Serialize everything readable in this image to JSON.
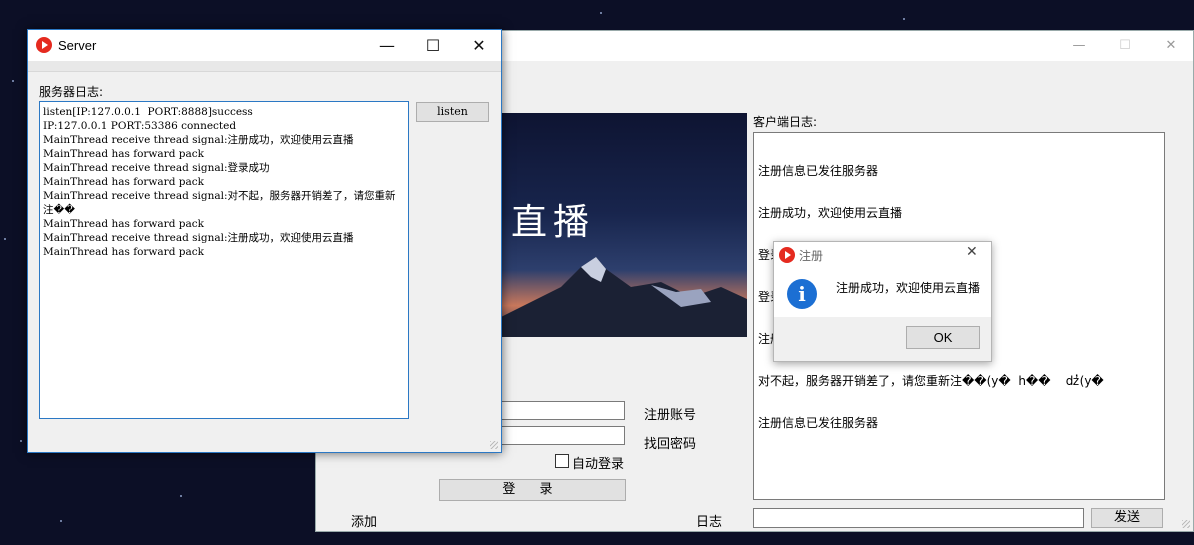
{
  "server": {
    "title": "Server",
    "log_label": "服务器日志:",
    "listen_label": "listen",
    "log_lines": [
      "listen[IP:127.0.0.1  PORT:8888]success",
      "IP:127.0.0.1 PORT:53386 connected",
      "MainThread receive thread signal:注册成功，欢迎使用云直播",
      "MainThread has forward pack",
      "MainThread receive thread signal:登录成功",
      "MainThread has forward pack",
      "MainThread receive thread signal:对不起，服务器开销差了，请您重新注��",
      "MainThread has forward pack",
      "MainThread receive thread signal:注册成功，欢迎使用云直播",
      "MainThread has forward pack"
    ]
  },
  "client": {
    "banner_text": "直播",
    "register_label": "注册账号",
    "recover_label": "找回密码",
    "auto_login_label": "自动登录",
    "login_label": "登 录",
    "add_label": "添加",
    "log_title": "日志",
    "client_log_label": "客户端日志:",
    "client_log_lines": [
      "注册信息已发往服务器",
      "注册成功，欢迎使用云直播",
      "登录信息已发往服务器",
      "登录成功",
      "注册信息已发往服务器",
      "对不起，服务器开销差了，请您重新注��(y�  h��    ǳ̓(y�",
      "注册信息已发往服务器"
    ],
    "send_label": "发送"
  },
  "dialog": {
    "title": "注册",
    "message": "注册成功，欢迎使用云直播",
    "ok_label": "OK"
  },
  "window_controls": {
    "minimize": "—",
    "maximize": "☐",
    "close": "✕"
  }
}
